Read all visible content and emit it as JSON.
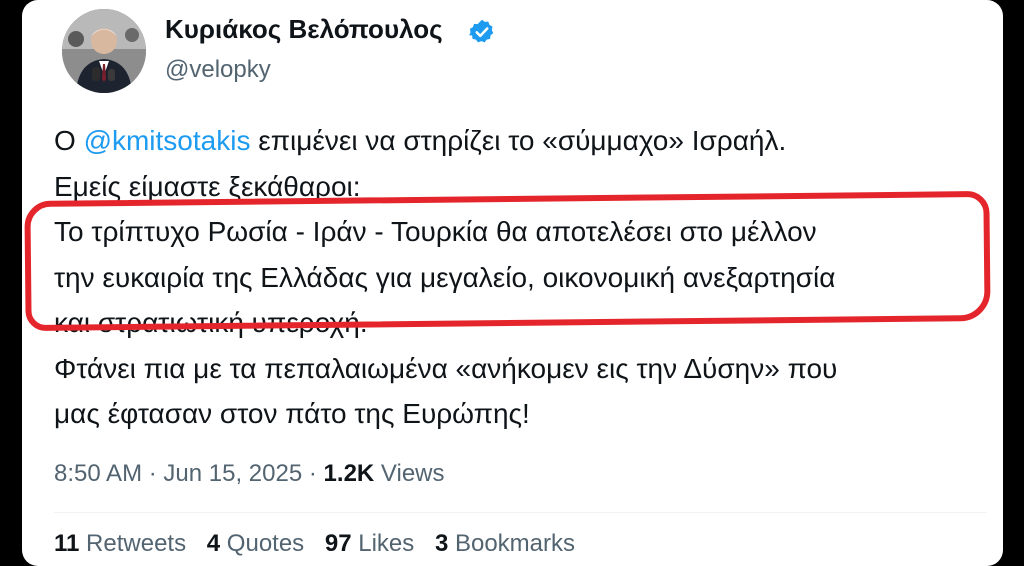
{
  "author": {
    "display_name": "Κυριάκος Βελόπουλος",
    "handle": "@velopky",
    "verified": true
  },
  "tweet": {
    "lines": [
      {
        "prefix": "Ο ",
        "mention": "@kmitsotakis",
        "suffix": " επιμένει να στηρίζει το «σύμμαχο» Ισραήλ."
      },
      {
        "text": "Εμείς είμαστε ξεκάθαροι:"
      },
      {
        "text": "Το τρίπτυχο Ρωσία - Ιράν - Τουρκία θα αποτελέσει στο μέλλον"
      },
      {
        "text": "την ευκαιρία της Ελλάδας για μεγαλείο, οικονομική ανεξαρτησία"
      },
      {
        "text": "και στρατιωτική υπεροχή."
      },
      {
        "text": "Φτάνει πια με τα πεπαλαιωμένα «ανήκομεν εις την Δύσην» που"
      },
      {
        "text": "μας έφτασαν στον πάτο της Ευρώπης!"
      }
    ]
  },
  "meta": {
    "time": "8:50 AM",
    "date": "Jun 15, 2025",
    "views_count": "1.2K",
    "views_label": "Views"
  },
  "stats": [
    {
      "count": "11",
      "label": "Retweets"
    },
    {
      "count": "4",
      "label": "Quotes"
    },
    {
      "count": "97",
      "label": "Likes"
    },
    {
      "count": "3",
      "label": "Bookmarks"
    }
  ],
  "colors": {
    "mention": "#1d9bf0",
    "highlight": "#e4262c",
    "verified": "#1d9bf0"
  }
}
